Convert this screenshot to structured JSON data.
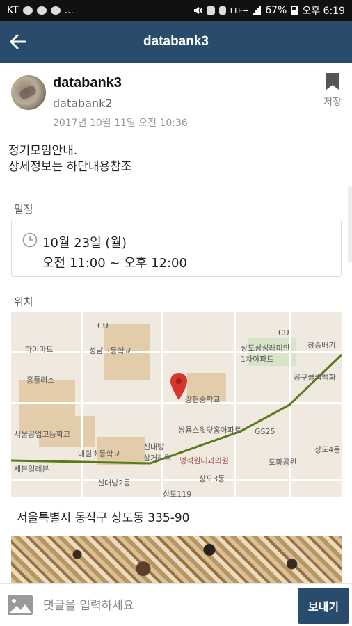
{
  "status_bar": {
    "carrier": "KT",
    "notification_icons": [
      "record-icon",
      "chat-icon",
      "talk-icon"
    ],
    "more": "...",
    "battery": "67%",
    "time": "오후 6:19",
    "network": "LTE+"
  },
  "app_bar": {
    "title": "databank3",
    "back_icon": "back-arrow-icon"
  },
  "post": {
    "author": "databank3",
    "group": "databank2",
    "date": "2017년 10월 11일 오전 10:36",
    "save_label": "저장",
    "body_line1": "정기모임안내.",
    "body_line2": "상세정보는 하단내용참조"
  },
  "schedule": {
    "label": "일정",
    "date": "10월 23일 (월)",
    "time": "오전 11:00 ~ 오후 12:00"
  },
  "location": {
    "label": "위치",
    "address": "서울특별시 동작구 상도동 335-90",
    "map_labels": {
      "cu1": "CU",
      "cu2": "CU",
      "himart": "하이마트",
      "school1": "성남고등학교",
      "school2": "상도삼성래미안\n1차아파트",
      "homeplus": "홈플러스",
      "school3": "강현중학교",
      "station1": "장승배기",
      "place1": "공구클럽백화",
      "apt": "쌍용스윗닷홈아파트",
      "gs25": "GS25",
      "school4": "서울공업고등학교",
      "school5": "대림초등학교",
      "station2": "신대방\n삼거리역",
      "hospital": "명석원내과의원",
      "park": "도화공원",
      "town1": "상도4동",
      "town2": "상도3동",
      "town3": "신대방2동",
      "town4": "상도119",
      "mart": "세븐일레븐"
    }
  },
  "comment_bar": {
    "placeholder": "댓글을 입력하세요",
    "send_label": "보내기"
  },
  "colors": {
    "primary": "#2a4c6c",
    "map_pin": "#d9362b",
    "subway_line": "#5a7a1a"
  }
}
